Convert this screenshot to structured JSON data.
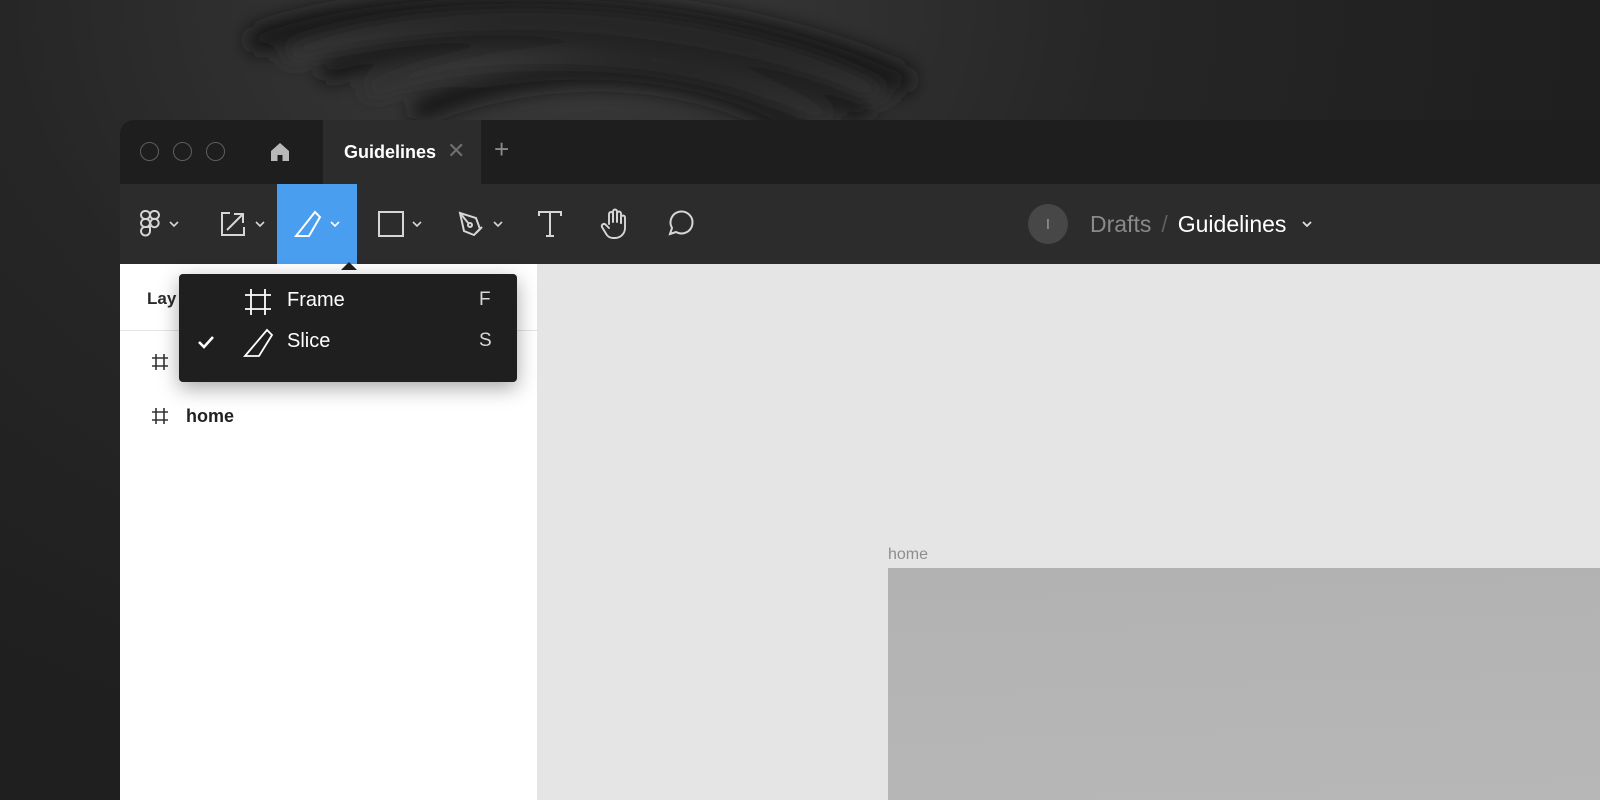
{
  "titlebar": {
    "tab_title": "Guidelines",
    "tab_close": "✕",
    "new_tab": "+"
  },
  "toolbar": {
    "tools": [
      {
        "name": "main-menu",
        "icon": "figma-logo-icon",
        "has_dropdown": true
      },
      {
        "name": "move",
        "icon": "move-scale-icon",
        "has_dropdown": true
      },
      {
        "name": "slice",
        "icon": "slice-icon",
        "has_dropdown": true,
        "active": true
      },
      {
        "name": "shape",
        "icon": "rectangle-icon",
        "has_dropdown": true
      },
      {
        "name": "pen",
        "icon": "pen-icon",
        "has_dropdown": true
      },
      {
        "name": "text",
        "icon": "text-icon",
        "has_dropdown": false
      },
      {
        "name": "hand",
        "icon": "hand-icon",
        "has_dropdown": false
      },
      {
        "name": "comment",
        "icon": "comment-icon",
        "has_dropdown": false
      }
    ],
    "active_color": "#4a9eef"
  },
  "breadcrumb": {
    "avatar_initial": "I",
    "project": "Drafts",
    "separator": "/",
    "file": "Guidelines"
  },
  "layers_panel": {
    "title": "Lay",
    "items": [
      {
        "label": "",
        "icon": "frame-hash-icon"
      },
      {
        "label": "home",
        "icon": "frame-hash-icon"
      }
    ]
  },
  "dropdown": {
    "items": [
      {
        "label": "Frame",
        "shortcut": "F",
        "icon": "frame-icon",
        "checked": false
      },
      {
        "label": "Slice",
        "shortcut": "S",
        "icon": "slice-icon",
        "checked": true
      }
    ]
  },
  "canvas": {
    "frame_label": "home"
  }
}
